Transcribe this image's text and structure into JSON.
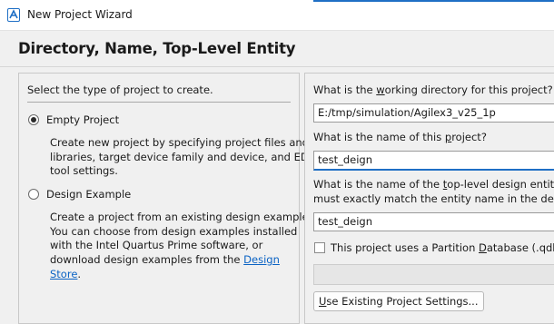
{
  "window": {
    "title": "New Project Wizard",
    "icon": "quartus-app-icon"
  },
  "page": {
    "heading": "Directory, Name, Top-Level Entity"
  },
  "left_panel": {
    "prompt": "Select the type of project to create.",
    "options": [
      {
        "label": "Empty Project",
        "selected": true,
        "description_lines": [
          "Create new project by specifying project files and",
          "libraries, target device family and device, and EDA",
          "tool settings."
        ]
      },
      {
        "label": "Design Example",
        "selected": false,
        "description_lines": [
          "Create a project from an existing design example.",
          "You can choose from design examples installed",
          "with the Intel Quartus Prime software, or",
          "download design examples from the "
        ],
        "link_part1": "Design",
        "link_part2": "Store",
        "trailing": "."
      }
    ]
  },
  "right_panel": {
    "working_dir_label": {
      "pre": "What is the ",
      "u": "w",
      "post": "orking directory for this project?"
    },
    "working_dir_value": "E:/tmp/simulation/Agilex3_v25_1p",
    "project_name_label": {
      "pre": "What is the name of this ",
      "u": "p",
      "post": "roject?"
    },
    "project_name_value": "test_deign",
    "top_entity_label_line1": {
      "pre": "What is the name of the ",
      "u": "t",
      "post": "op-level design entity for"
    },
    "top_entity_label_line2": "must exactly match the entity name in the design",
    "top_entity_value": "test_deign",
    "partition_checkbox": {
      "pre": "This project uses a Partition ",
      "u": "D",
      "post": "atabase (.qdb) fil",
      "checked": false
    },
    "partition_field_value": "",
    "use_existing_button": {
      "u": "U",
      "post": "se Existing Project Settings..."
    }
  }
}
